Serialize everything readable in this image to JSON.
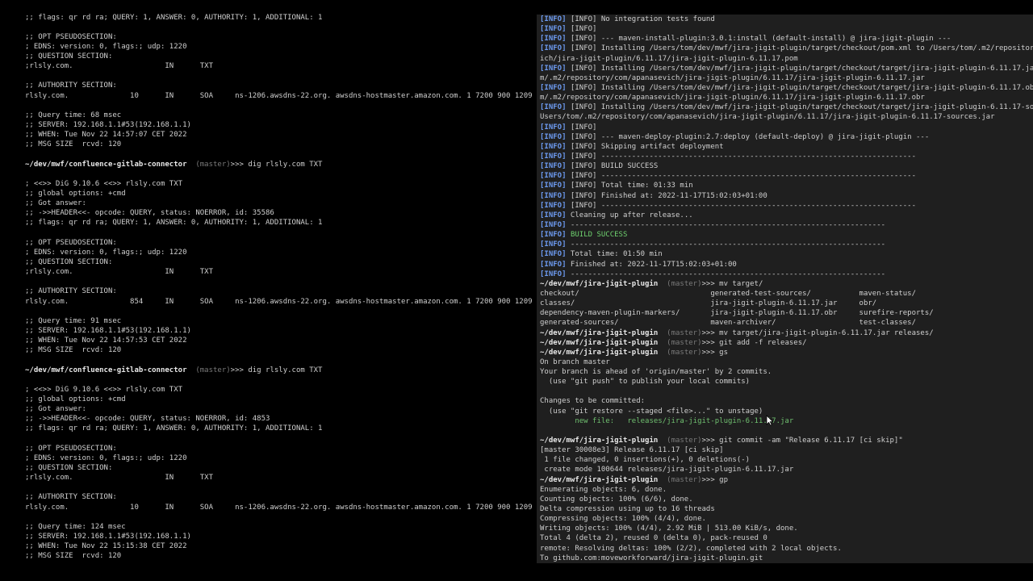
{
  "colors": {
    "background": "#000000",
    "right_pane_background": "#1f1f1f",
    "text": "#cfcfcf",
    "info_tag": "#6d9bf1",
    "success": "#6fd26f"
  },
  "left_terminal": {
    "lines": [
      [
        {
          "t": ";; flags: qr rd ra; QUERY: 1, ANSWER: 0, AUTHORITY: 1, ADDITIONAL: 1",
          "c": ""
        }
      ],
      [],
      [
        {
          "t": ";; OPT PSEUDOSECTION:",
          "c": ""
        }
      ],
      [
        {
          "t": "; EDNS: version: 0, flags:; udp: 1220",
          "c": ""
        }
      ],
      [
        {
          "t": ";; QUESTION SECTION:",
          "c": ""
        }
      ],
      [
        {
          "t": ";rlsly.com.                     IN      TXT",
          "c": ""
        }
      ],
      [],
      [
        {
          "t": ";; AUTHORITY SECTION:",
          "c": ""
        }
      ],
      [
        {
          "t": "rlsly.com.              10      IN      SOA     ns-1206.awsdns-22.org. awsdns-hostmaster.amazon.com. 1 7200 900 1209600 86400",
          "c": ""
        }
      ],
      [],
      [
        {
          "t": ";; Query time: 68 msec",
          "c": ""
        }
      ],
      [
        {
          "t": ";; SERVER: 192.168.1.1#53(192.168.1.1)",
          "c": ""
        }
      ],
      [
        {
          "t": ";; WHEN: Tue Nov 22 14:57:07 CET 2022",
          "c": ""
        }
      ],
      [
        {
          "t": ";; MSG SIZE  rcvd: 120",
          "c": ""
        }
      ],
      [],
      [
        {
          "t": "~/dev/mwf/confluence-gitlab-connector",
          "c": "path"
        },
        {
          "t": "  (master)",
          "c": "branch"
        },
        {
          "t": ">>> dig rlsly.com TXT",
          "c": ""
        }
      ],
      [],
      [
        {
          "t": "; <<>> DiG 9.10.6 <<>> rlsly.com TXT",
          "c": ""
        }
      ],
      [
        {
          "t": ";; global options: +cmd",
          "c": ""
        }
      ],
      [
        {
          "t": ";; Got answer:",
          "c": ""
        }
      ],
      [
        {
          "t": ";; ->>HEADER<<- opcode: QUERY, status: NOERROR, id: 35586",
          "c": ""
        }
      ],
      [
        {
          "t": ";; flags: qr rd ra; QUERY: 1, ANSWER: 0, AUTHORITY: 1, ADDITIONAL: 1",
          "c": ""
        }
      ],
      [],
      [
        {
          "t": ";; OPT PSEUDOSECTION:",
          "c": ""
        }
      ],
      [
        {
          "t": "; EDNS: version: 0, flags:; udp: 1220",
          "c": ""
        }
      ],
      [
        {
          "t": ";; QUESTION SECTION:",
          "c": ""
        }
      ],
      [
        {
          "t": ";rlsly.com.                     IN      TXT",
          "c": ""
        }
      ],
      [],
      [
        {
          "t": ";; AUTHORITY SECTION:",
          "c": ""
        }
      ],
      [
        {
          "t": "rlsly.com.              854     IN      SOA     ns-1206.awsdns-22.org. awsdns-hostmaster.amazon.com. 1 7200 900 1209600 86400",
          "c": ""
        }
      ],
      [],
      [
        {
          "t": ";; Query time: 91 msec",
          "c": ""
        }
      ],
      [
        {
          "t": ";; SERVER: 192.168.1.1#53(192.168.1.1)",
          "c": ""
        }
      ],
      [
        {
          "t": ";; WHEN: Tue Nov 22 14:57:53 CET 2022",
          "c": ""
        }
      ],
      [
        {
          "t": ";; MSG SIZE  rcvd: 120",
          "c": ""
        }
      ],
      [],
      [
        {
          "t": "~/dev/mwf/confluence-gitlab-connector",
          "c": "path"
        },
        {
          "t": "  (master)",
          "c": "branch"
        },
        {
          "t": ">>> dig rlsly.com TXT",
          "c": ""
        }
      ],
      [],
      [
        {
          "t": "; <<>> DiG 9.10.6 <<>> rlsly.com TXT",
          "c": ""
        }
      ],
      [
        {
          "t": ";; global options: +cmd",
          "c": ""
        }
      ],
      [
        {
          "t": ";; Got answer:",
          "c": ""
        }
      ],
      [
        {
          "t": ";; ->>HEADER<<- opcode: QUERY, status: NOERROR, id: 4853",
          "c": ""
        }
      ],
      [
        {
          "t": ";; flags: qr rd ra; QUERY: 1, ANSWER: 0, AUTHORITY: 1, ADDITIONAL: 1",
          "c": ""
        }
      ],
      [],
      [
        {
          "t": ";; OPT PSEUDOSECTION:",
          "c": ""
        }
      ],
      [
        {
          "t": "; EDNS: version: 0, flags:; udp: 1220",
          "c": ""
        }
      ],
      [
        {
          "t": ";; QUESTION SECTION:",
          "c": ""
        }
      ],
      [
        {
          "t": ";rlsly.com.                     IN      TXT",
          "c": ""
        }
      ],
      [],
      [
        {
          "t": ";; AUTHORITY SECTION:",
          "c": ""
        }
      ],
      [
        {
          "t": "rlsly.com.              10      IN      SOA     ns-1206.awsdns-22.org. awsdns-hostmaster.amazon.com. 1 7200 900 1209600 86400",
          "c": ""
        }
      ],
      [],
      [
        {
          "t": ";; Query time: 124 msec",
          "c": ""
        }
      ],
      [
        {
          "t": ";; SERVER: 192.168.1.1#53(192.168.1.1)",
          "c": ""
        }
      ],
      [
        {
          "t": ";; WHEN: Tue Nov 22 15:15:38 CET 2022",
          "c": ""
        }
      ],
      [
        {
          "t": ";; MSG SIZE  rcvd: 120",
          "c": ""
        }
      ]
    ]
  },
  "right_terminal": {
    "lines": [
      [
        {
          "t": "[INFO]",
          "c": "info"
        },
        {
          "t": " [INFO] No integration tests found",
          "c": ""
        }
      ],
      [
        {
          "t": "[INFO]",
          "c": "info"
        },
        {
          "t": " [INFO]",
          "c": ""
        }
      ],
      [
        {
          "t": "[INFO]",
          "c": "info"
        },
        {
          "t": " [INFO] --- maven-install-plugin:3.0.1:install (default-install) @ jira-jigit-plugin ---",
          "c": ""
        }
      ],
      [
        {
          "t": "[INFO]",
          "c": "info"
        },
        {
          "t": " [INFO] Installing /Users/tom/dev/mwf/jira-jigit-plugin/target/checkout/pom.xml to /Users/tom/.m2/repository/com/apanasevich/jira-jigit-plugin/6.11.17/jira-jigit-plugin-6.11.17.pom",
          "c": ""
        }
      ],
      [
        {
          "t": "ich/jira-jigit-plugin/6.11.17/jira-jigit-plugin-6.11.17.pom",
          "c": ""
        }
      ],
      [
        {
          "t": "[INFO]",
          "c": "info"
        },
        {
          "t": " [INFO] Installing /Users/tom/dev/mwf/jira-jigit-plugin/target/checkout/target/jira-jigit-plugin-6.11.17.jar to /Users/tom/",
          "c": ""
        }
      ],
      [
        {
          "t": "m/.m2/repository/com/apanasevich/jira-jigit-plugin/6.11.17/jira-jigit-plugin-6.11.17.jar",
          "c": ""
        }
      ],
      [
        {
          "t": "[INFO]",
          "c": "info"
        },
        {
          "t": " [INFO] Installing /Users/tom/dev/mwf/jira-jigit-plugin/target/checkout/target/jira-jigit-plugin-6.11.17.obr to /Users/tom/",
          "c": ""
        }
      ],
      [
        {
          "t": "m/.m2/repository/com/apanasevich/jira-jigit-plugin/6.11.17/jira-jigit-plugin-6.11.17.obr",
          "c": ""
        }
      ],
      [
        {
          "t": "[INFO]",
          "c": "info"
        },
        {
          "t": " [INFO] Installing /Users/tom/dev/mwf/jira-jigit-plugin/target/checkout/target/jira-jigit-plugin-6.11.17-sources.jar to /",
          "c": ""
        }
      ],
      [
        {
          "t": "Users/tom/.m2/repository/com/apanasevich/jira-jigit-plugin/6.11.17/jira-jigit-plugin-6.11.17-sources.jar",
          "c": ""
        }
      ],
      [
        {
          "t": "[INFO]",
          "c": "info"
        },
        {
          "t": " [INFO]",
          "c": ""
        }
      ],
      [
        {
          "t": "[INFO]",
          "c": "info"
        },
        {
          "t": " [INFO] --- maven-deploy-plugin:2.7:deploy (default-deploy) @ jira-jigit-plugin ---",
          "c": ""
        }
      ],
      [
        {
          "t": "[INFO]",
          "c": "info"
        },
        {
          "t": " [INFO] Skipping artifact deployment",
          "c": ""
        }
      ],
      [
        {
          "t": "[INFO]",
          "c": "info"
        },
        {
          "t": " [INFO] ------------------------------------------------------------------------",
          "c": ""
        }
      ],
      [
        {
          "t": "[INFO]",
          "c": "info"
        },
        {
          "t": " [INFO] BUILD SUCCESS",
          "c": ""
        }
      ],
      [
        {
          "t": "[INFO]",
          "c": "info"
        },
        {
          "t": " [INFO] ------------------------------------------------------------------------",
          "c": ""
        }
      ],
      [
        {
          "t": "[INFO]",
          "c": "info"
        },
        {
          "t": " [INFO] Total time: 01:33 min",
          "c": ""
        }
      ],
      [
        {
          "t": "[INFO]",
          "c": "info"
        },
        {
          "t": " [INFO] Finished at: 2022-11-17T15:02:03+01:00",
          "c": ""
        }
      ],
      [
        {
          "t": "[INFO]",
          "c": "info"
        },
        {
          "t": " [INFO] ------------------------------------------------------------------------",
          "c": ""
        }
      ],
      [
        {
          "t": "[INFO]",
          "c": "info"
        },
        {
          "t": " Cleaning up after release...",
          "c": ""
        }
      ],
      [
        {
          "t": "[INFO]",
          "c": "info"
        },
        {
          "t": " ------------------------------------------------------------------------",
          "c": ""
        }
      ],
      [
        {
          "t": "[INFO]",
          "c": "info"
        },
        {
          "t": " ",
          "c": ""
        },
        {
          "t": "BUILD SUCCESS",
          "c": "ok"
        }
      ],
      [
        {
          "t": "[INFO]",
          "c": "info"
        },
        {
          "t": " ------------------------------------------------------------------------",
          "c": ""
        }
      ],
      [
        {
          "t": "[INFO]",
          "c": "info"
        },
        {
          "t": " Total time: 01:50 min",
          "c": ""
        }
      ],
      [
        {
          "t": "[INFO]",
          "c": "info"
        },
        {
          "t": " Finished at: 2022-11-17T15:02:03+01:00",
          "c": ""
        }
      ],
      [
        {
          "t": "[INFO]",
          "c": "info"
        },
        {
          "t": " ------------------------------------------------------------------------",
          "c": ""
        }
      ],
      [
        {
          "t": "~/dev/mwf/jira-jigit-plugin",
          "c": "path"
        },
        {
          "t": "  (master)",
          "c": "branch"
        },
        {
          "t": ">>> mv target/",
          "c": ""
        }
      ],
      [
        {
          "t": "checkout/                              generated-test-sources/           maven-status/",
          "c": ""
        }
      ],
      [
        {
          "t": "classes/                               jira-jigit-plugin-6.11.17.jar     obr/",
          "c": ""
        }
      ],
      [
        {
          "t": "dependency-maven-plugin-markers/       jira-jigit-plugin-6.11.17.obr     surefire-reports/",
          "c": ""
        }
      ],
      [
        {
          "t": "generated-sources/                     maven-archiver/                   test-classes/",
          "c": ""
        }
      ],
      [
        {
          "t": "~/dev/mwf/jira-jigit-plugin",
          "c": "path"
        },
        {
          "t": "  (master)",
          "c": "branch"
        },
        {
          "t": ">>> mv target/jira-jigit-plugin-6.11.17.jar releases/",
          "c": ""
        }
      ],
      [
        {
          "t": "~/dev/mwf/jira-jigit-plugin",
          "c": "path"
        },
        {
          "t": "  (master)",
          "c": "branch"
        },
        {
          "t": ">>> git add -f releases/",
          "c": ""
        }
      ],
      [
        {
          "t": "~/dev/mwf/jira-jigit-plugin",
          "c": "path"
        },
        {
          "t": "  (master)",
          "c": "branch"
        },
        {
          "t": ">>> gs",
          "c": ""
        }
      ],
      [
        {
          "t": "On branch master",
          "c": ""
        }
      ],
      [
        {
          "t": "Your branch is ahead of 'origin/master' by 2 commits.",
          "c": ""
        }
      ],
      [
        {
          "t": "  (use \"git push\" to publish your local commits)",
          "c": ""
        }
      ],
      [],
      [
        {
          "t": "Changes to be committed:",
          "c": ""
        }
      ],
      [
        {
          "t": "  (use \"git restore --staged <file>...\" to unstage)",
          "c": ""
        }
      ],
      [
        {
          "t": "        new file:   releases/jira-jigit-plugin-6.11.17.jar",
          "c": "added"
        }
      ],
      [],
      [
        {
          "t": "~/dev/mwf/jira-jigit-plugin",
          "c": "path"
        },
        {
          "t": "  (master)",
          "c": "branch"
        },
        {
          "t": ">>> git commit -am \"Release 6.11.17 [ci skip]\"",
          "c": ""
        }
      ],
      [
        {
          "t": "[master 30008e3] Release 6.11.17 [ci skip]",
          "c": ""
        }
      ],
      [
        {
          "t": " 1 file changed, 0 insertions(+), 0 deletions(-)",
          "c": ""
        }
      ],
      [
        {
          "t": " create mode 100644 releases/jira-jigit-plugin-6.11.17.jar",
          "c": ""
        }
      ],
      [
        {
          "t": "~/dev/mwf/jira-jigit-plugin",
          "c": "path"
        },
        {
          "t": "  (master)",
          "c": "branch"
        },
        {
          "t": ">>> gp",
          "c": ""
        }
      ],
      [
        {
          "t": "Enumerating objects: 6, done.",
          "c": ""
        }
      ],
      [
        {
          "t": "Counting objects: 100% (6/6), done.",
          "c": ""
        }
      ],
      [
        {
          "t": "Delta compression using up to 16 threads",
          "c": ""
        }
      ],
      [
        {
          "t": "Compressing objects: 100% (4/4), done.",
          "c": ""
        }
      ],
      [
        {
          "t": "Writing objects: 100% (4/4), 2.92 MiB | 513.00 KiB/s, done.",
          "c": ""
        }
      ],
      [
        {
          "t": "Total 4 (delta 2), reused 0 (delta 0), pack-reused 0",
          "c": ""
        }
      ],
      [
        {
          "t": "remote: Resolving deltas: 100% (2/2), completed with 2 local objects.",
          "c": ""
        }
      ],
      [
        {
          "t": "To github.com:moveworkforward/jira-jigit-plugin.git",
          "c": ""
        }
      ]
    ]
  }
}
